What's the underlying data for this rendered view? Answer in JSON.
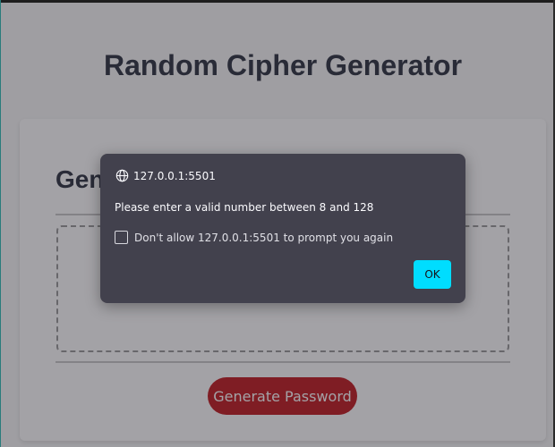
{
  "page": {
    "title": "Random Cipher Generator"
  },
  "card": {
    "title": "Generate a Password",
    "generate_button_label": "Generate Password"
  },
  "dialog": {
    "origin": "127.0.0.1:5501",
    "message": "Please enter a valid number between 8 and 128",
    "checkbox_label": "Don't allow 127.0.0.1:5501 to prompt you again",
    "checkbox_checked": false,
    "ok_label": "OK",
    "icon": "globe-icon"
  },
  "colors": {
    "button": "#c11a1f",
    "dialog_bg": "#42414d",
    "ok_accent": "#00ddff",
    "title_text": "#2d3340"
  }
}
